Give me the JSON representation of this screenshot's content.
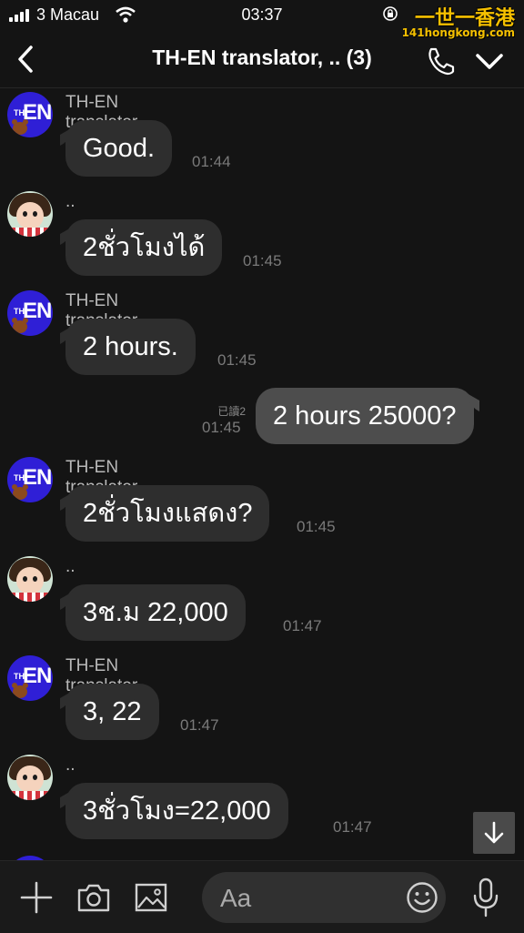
{
  "status_bar": {
    "carrier": "3 Macau",
    "time": "03:37"
  },
  "watermark": {
    "line1": "一世一香港",
    "line2": "141hongkong.com"
  },
  "header": {
    "title": "TH-EN translator, .. (3)"
  },
  "messages": [
    {
      "sender": "TH-EN translator",
      "text": "Good.",
      "time": "01:44"
    },
    {
      "sender": "..",
      "text": "2ชั่วโมงได้",
      "time": "01:45"
    },
    {
      "sender": "TH-EN translator",
      "text": "2 hours.",
      "time": "01:45"
    },
    {
      "text": "2 hours 25000?",
      "time": "01:45",
      "read": "已讀2"
    },
    {
      "sender": "TH-EN translator",
      "text": "2ชั่วโมงแสดง?",
      "time": "01:45"
    },
    {
      "sender": "..",
      "text": "3ช.ม 22,000",
      "time": "01:47"
    },
    {
      "sender": "TH-EN translator",
      "text": "3, 22",
      "time": "01:47"
    },
    {
      "sender": "..",
      "text": "3ชั่วโมง=22,000",
      "time": "01:47"
    }
  ],
  "input": {
    "placeholder": "Aa"
  },
  "icons": {
    "back": "chevron-left-icon",
    "call": "phone-icon",
    "menu": "chevron-down-icon",
    "scroll": "arrow-down-icon",
    "add": "plus-icon",
    "camera": "camera-icon",
    "gallery": "image-icon",
    "emoji": "emoji-icon",
    "mic": "microphone-icon"
  }
}
